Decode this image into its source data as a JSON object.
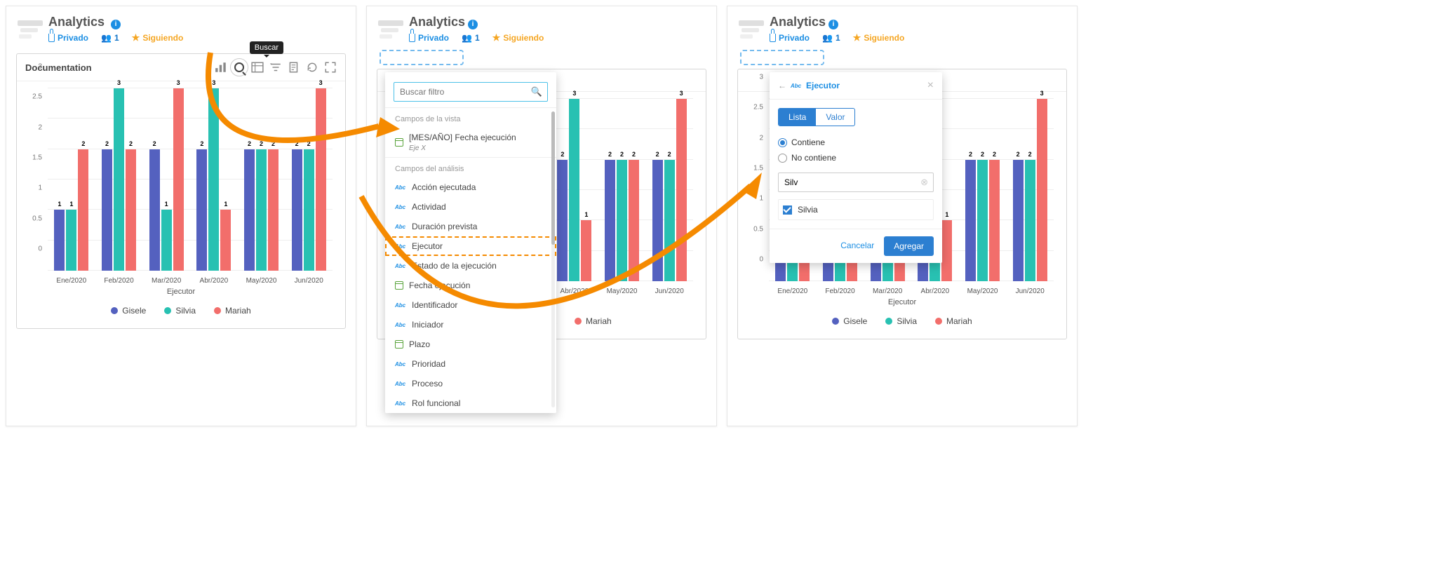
{
  "header": {
    "title": "Analytics",
    "privacy": "Privado",
    "group_count": "1",
    "following": "Siguiendo"
  },
  "card": {
    "title": "Documentation",
    "tooltip_search": "Buscar"
  },
  "chart_data": {
    "type": "bar",
    "xlabel": "Ejecutor",
    "ylabel": "",
    "ylim": [
      0,
      3
    ],
    "y_ticks": [
      0,
      0.5,
      1,
      1.5,
      2,
      2.5,
      3
    ],
    "categories": [
      "Ene/2020",
      "Feb/2020",
      "Mar/2020",
      "Abr/2020",
      "May/2020",
      "Jun/2020"
    ],
    "series": [
      {
        "name": "Gisele",
        "color": "#5461bf",
        "values": [
          1,
          2,
          2,
          2,
          2,
          2
        ]
      },
      {
        "name": "Silvia",
        "color": "#28c1b2",
        "values": [
          1,
          3,
          1,
          3,
          2,
          2
        ]
      },
      {
        "name": "Mariah",
        "color": "#f26e6b",
        "values": [
          2,
          2,
          3,
          1,
          2,
          3
        ]
      }
    ]
  },
  "popup": {
    "search_placeholder": "Buscar filtro",
    "section_view": "Campos de la vista",
    "section_analysis": "Campos del análisis",
    "item_fecha_ejec_axis": "[MES/AÑO] Fecha ejecución",
    "item_fecha_ejec_sub": "Eje X",
    "items_analysis": [
      "Acción ejecutada",
      "Actividad",
      "Duración prevista",
      "Ejecutor",
      "Estado de la ejecución",
      "Fecha ejecución",
      "Identificador",
      "Iniciador",
      "Plazo",
      "Prioridad",
      "Proceso",
      "Rol funcional"
    ]
  },
  "dialog": {
    "title_field": "Ejecutor",
    "tab_list": "Lista",
    "tab_value": "Valor",
    "radio_contains": "Contiene",
    "radio_not_contains": "No contiene",
    "input_value": "Silv",
    "option_checked": "Silvia",
    "cancel": "Cancelar",
    "add": "Agregar"
  }
}
